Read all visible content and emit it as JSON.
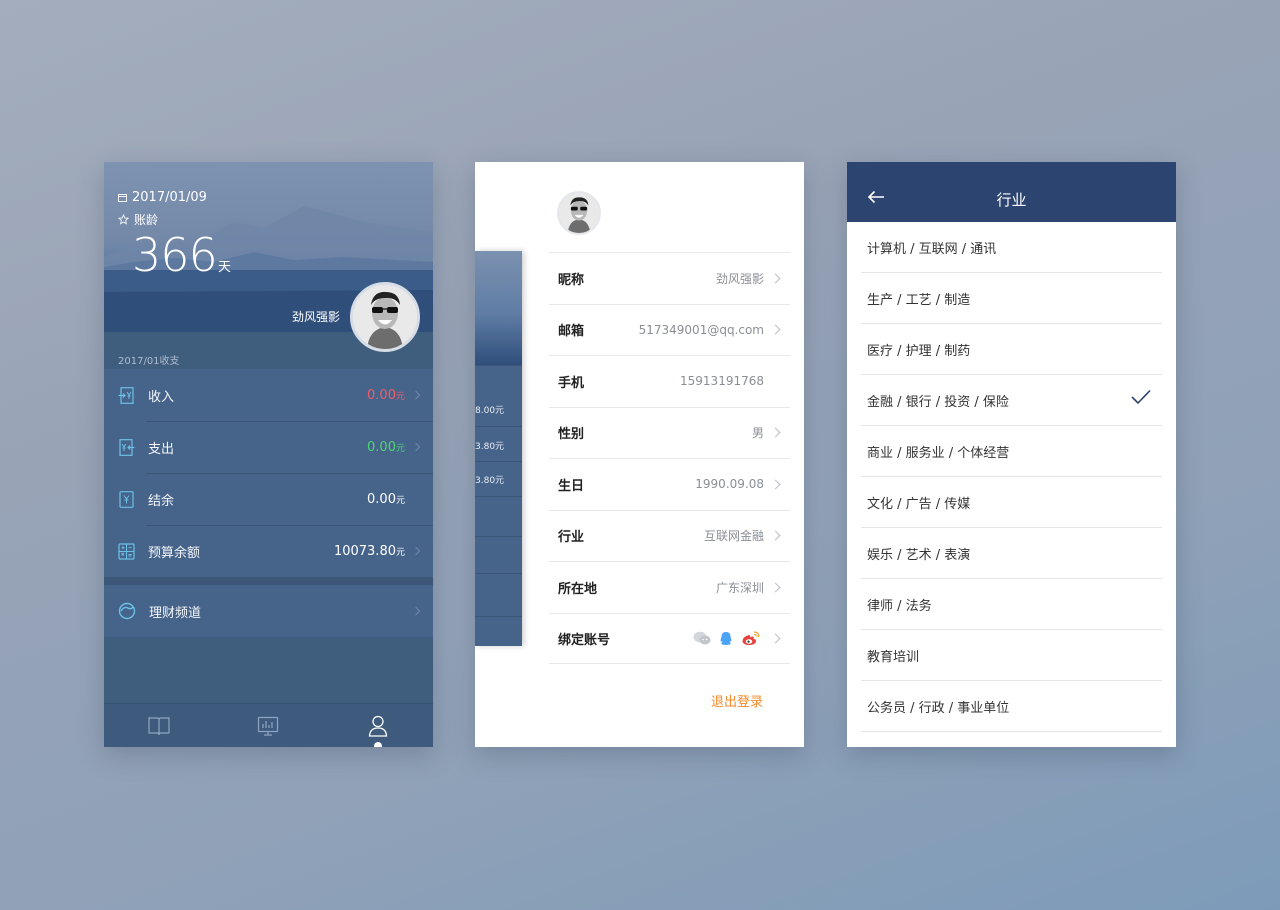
{
  "screen1": {
    "date": "2017/01/09",
    "age_label": "账龄",
    "age_value": "366",
    "age_unit": "天",
    "username": "劲风强影",
    "period_label": "2017/01收支",
    "rows": [
      {
        "label": "收入",
        "value": "0.00",
        "unit": "元",
        "color": "#ef5d6b",
        "icon": "income-icon"
      },
      {
        "label": "支出",
        "value": "0.00",
        "unit": "元",
        "color": "#4fd673",
        "icon": "expense-icon"
      },
      {
        "label": "结余",
        "value": "0.00",
        "unit": "元",
        "color": "#ffffff",
        "icon": "balance-icon"
      },
      {
        "label": "预算余额",
        "value": "10073.80",
        "unit": "元",
        "color": "#ffffff",
        "icon": "budget-icon"
      }
    ],
    "wealth_label": "理财频道",
    "tabs": [
      "book-icon",
      "chart-icon",
      "user-icon"
    ]
  },
  "screen2": {
    "peek_values": [
      "8.00元",
      "3.80元",
      "3.80元"
    ],
    "rows": [
      {
        "key": "昵称",
        "value": "劲风强影"
      },
      {
        "key": "邮箱",
        "value": "517349001@qq.com"
      },
      {
        "key": "手机",
        "value": "15913191768"
      },
      {
        "key": "性别",
        "value": "男"
      },
      {
        "key": "生日",
        "value": "1990.09.08"
      },
      {
        "key": "行业",
        "value": "互联网金融"
      },
      {
        "key": "所在地",
        "value": "广东深圳"
      },
      {
        "key": "绑定账号",
        "value": ""
      }
    ],
    "logout": "退出登录"
  },
  "screen3": {
    "title": "行业",
    "items": [
      "计算机 / 互联网 / 通讯",
      "生产 / 工艺 / 制造",
      "医疗 / 护理 / 制药",
      "金融 / 银行 / 投资 / 保险",
      "商业 / 服务业 / 个体经营",
      "文化 / 广告 / 传媒",
      "娱乐 / 艺术 / 表演",
      "律师 / 法务",
      "教育培训",
      "公务员 / 行政 / 事业单位"
    ],
    "selected_index": 3
  }
}
